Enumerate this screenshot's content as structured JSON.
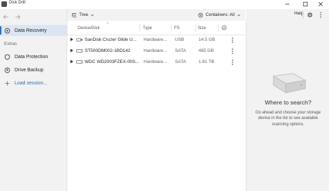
{
  "window": {
    "title": "Disk Drill"
  },
  "sidebar": {
    "items": [
      {
        "label": "Data Recovery"
      },
      {
        "label": "Data Protection"
      },
      {
        "label": "Drive Backup"
      }
    ],
    "section_label": "Extras",
    "load_session": "Load session..."
  },
  "toolbar": {
    "view_label": "Tree",
    "containers_label": "Containers: All"
  },
  "right_toolbar": {
    "help_label": "Help"
  },
  "table": {
    "columns": [
      "Device/Disk",
      "Type",
      "FS",
      "Size"
    ],
    "rows": [
      {
        "name": "SanDisk Cruzer Glide U...",
        "type": "Hardware...",
        "fs": "USB",
        "size": "14.5 GB"
      },
      {
        "name": "ST500DM002-1BD142",
        "type": "Hardware...",
        "fs": "SATA",
        "size": "465 GB"
      },
      {
        "name": "WDC WD2003FZEX-00S...",
        "type": "Hardware...",
        "fs": "SATA",
        "size": "1.81 TB"
      }
    ]
  },
  "info_panel": {
    "title": "Where to search?",
    "description": "Go ahead and choose your storage device in the list to see available scanning options."
  },
  "colors": {
    "accent": "#2b6cc4",
    "sidebar_bg": "#f2f2f2",
    "active_bg": "#dbe5f3"
  }
}
